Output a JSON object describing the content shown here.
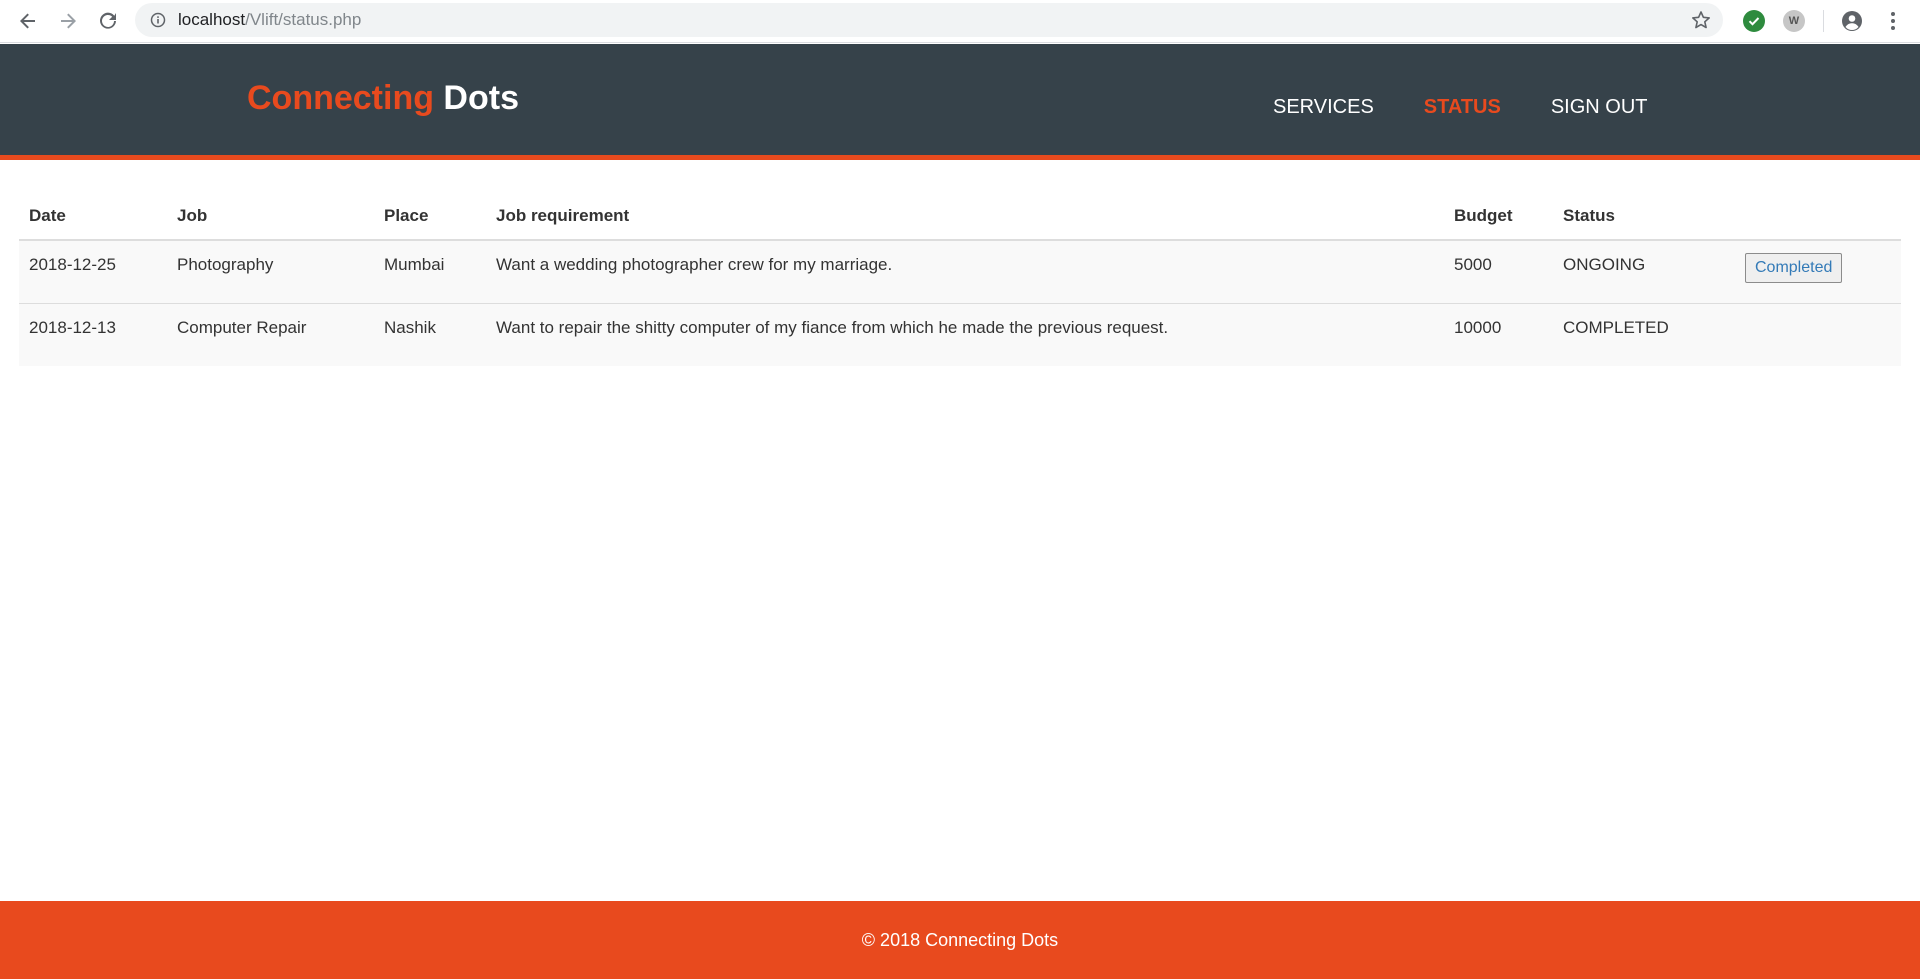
{
  "browser": {
    "url_host": "localhost",
    "url_path": "/Vlift/status.php",
    "ext_w_label": "W"
  },
  "site": {
    "logo_accent": "Connecting",
    "logo_rest": " Dots",
    "nav": [
      {
        "label": "SERVICES",
        "active": false
      },
      {
        "label": "STATUS",
        "active": true
      },
      {
        "label": "SIGN OUT",
        "active": false
      }
    ]
  },
  "table": {
    "headers": [
      "Date",
      "Job",
      "Place",
      "Job requirement",
      "Budget",
      "Status",
      ""
    ],
    "rows": [
      {
        "date": "2018-12-25",
        "job": "Photography",
        "place": "Mumbai",
        "requirement": "Want a wedding photographer crew for my marriage.",
        "budget": "5000",
        "status": "ONGOING",
        "action": "Completed"
      },
      {
        "date": "2018-12-13",
        "job": "Computer Repair",
        "place": "Nashik",
        "requirement": "Want to repair the shitty computer of my fiance from which he made the previous request.",
        "budget": "10000",
        "status": "COMPLETED",
        "action": ""
      }
    ]
  },
  "footer": {
    "text": "© 2018 Connecting Dots"
  },
  "colors": {
    "header_bg": "#36424a",
    "accent": "#e84a1e",
    "link": "#337ab7"
  }
}
